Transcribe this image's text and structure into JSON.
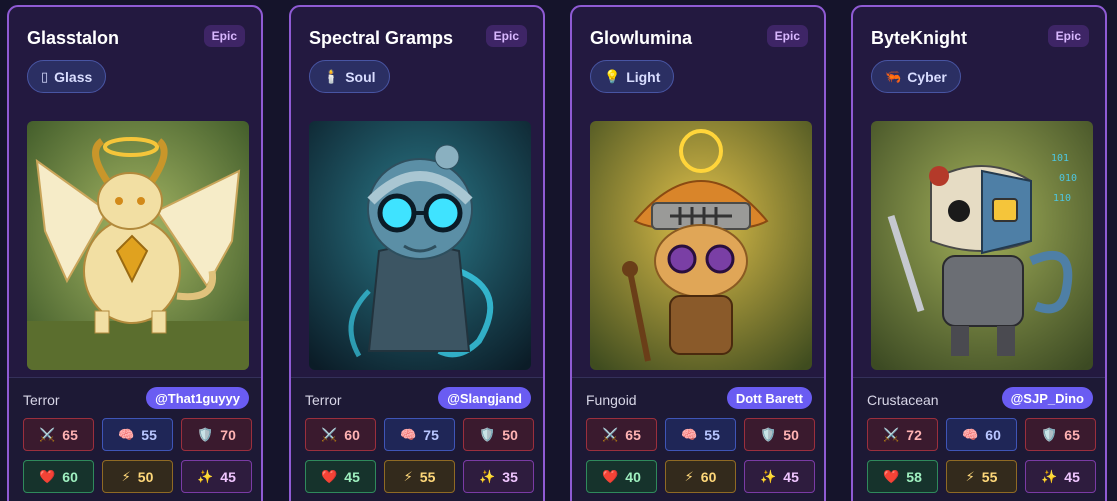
{
  "cards": [
    {
      "name": "Glasstalon",
      "rarity": "Epic",
      "type_icon": "▯",
      "type": "Glass",
      "class": "Terror",
      "creator": "@That1guyyy",
      "art": {
        "bg1": "#8ca04e",
        "bg2": "#3f5a29",
        "body": "#f2dfa3",
        "accent": "#e0a21f",
        "subject": "winged-dragon-with-halo"
      },
      "stats": {
        "atk": "65",
        "int": "55",
        "def": "70",
        "hp": "60",
        "spd": "50",
        "mag": "45"
      }
    },
    {
      "name": "Spectral Gramps",
      "rarity": "Epic",
      "type_icon": "🕯️",
      "type": "Soul",
      "class": "Terror",
      "creator": "@Slangjand",
      "art": {
        "bg1": "#1d5a6a",
        "bg2": "#0e2330",
        "body": "#5b8fa6",
        "accent": "#3fe3ff",
        "subject": "ghost-old-man-with-glasses"
      },
      "stats": {
        "atk": "60",
        "int": "75",
        "def": "50",
        "hp": "45",
        "spd": "55",
        "mag": "35"
      }
    },
    {
      "name": "Glowlumina",
      "rarity": "Epic",
      "type_icon": "💡",
      "type": "Light",
      "class": "Fungoid",
      "creator": "Dott Barett",
      "art": {
        "bg1": "#c7a93a",
        "bg2": "#4a5a22",
        "body": "#d9852a",
        "accent": "#ffd53a",
        "subject": "mushroom-ninja-with-staff"
      },
      "stats": {
        "atk": "65",
        "int": "55",
        "def": "50",
        "hp": "40",
        "spd": "60",
        "mag": "45"
      }
    },
    {
      "name": "ByteKnight",
      "rarity": "Epic",
      "type_icon": "🦐",
      "type": "Cyber",
      "class": "Crustacean",
      "creator": "@SJP_Dino",
      "art": {
        "bg1": "#8a9a45",
        "bg2": "#3c4a23",
        "body": "#6b6e74",
        "accent": "#4ec6e0",
        "subject": "skull-crab-knight-with-sword"
      },
      "stats": {
        "atk": "72",
        "int": "60",
        "def": "65",
        "hp": "58",
        "spd": "55",
        "mag": "45"
      }
    }
  ],
  "stat_icons": {
    "atk": "⚔️",
    "int": "🧠",
    "def": "🛡️",
    "hp": "❤️",
    "spd": "⚡",
    "mag": "✨"
  }
}
